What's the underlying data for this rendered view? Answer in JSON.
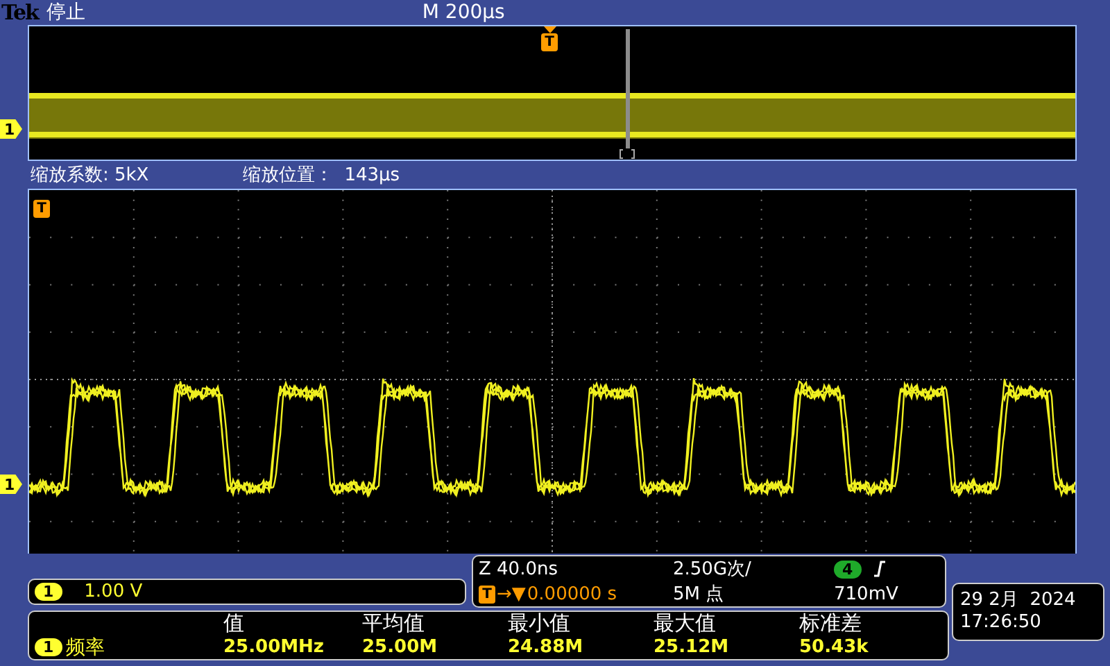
{
  "header": {
    "brand": "Tek",
    "status": "停止",
    "timebase": "M 200µs"
  },
  "overview": {
    "trigger_marker": "T",
    "channel_marker": "1"
  },
  "zoom": {
    "factor": "缩放系数: 5kX",
    "position_label": "缩放位置：",
    "position": "143µs"
  },
  "main": {
    "trigger_marker": "T",
    "channel_marker": "1"
  },
  "channel": {
    "number": "1",
    "scale": "1.00 V"
  },
  "acquisition": {
    "zoom_scale": "Z 40.0ns",
    "sample_rate": "2.50G次/",
    "trigger_source": {
      "label": "4",
      "color": "#1faa2a"
    },
    "trigger_marker": "T",
    "trigger_arrows": "→▼",
    "trigger_position": "0.00000 s",
    "record_length": "5M 点",
    "trigger_level": "710mV"
  },
  "datetime": {
    "date": "29 2月  2024",
    "time": "17:26:50"
  },
  "measurements": {
    "columns": [
      "值",
      "平均值",
      "最小值",
      "最大值",
      "标准差"
    ],
    "rows": [
      {
        "channel": "1",
        "name": "频率",
        "values": [
          "25.00MHz",
          "25.00M",
          "24.88M",
          "25.12M",
          "50.43k"
        ]
      }
    ]
  }
}
